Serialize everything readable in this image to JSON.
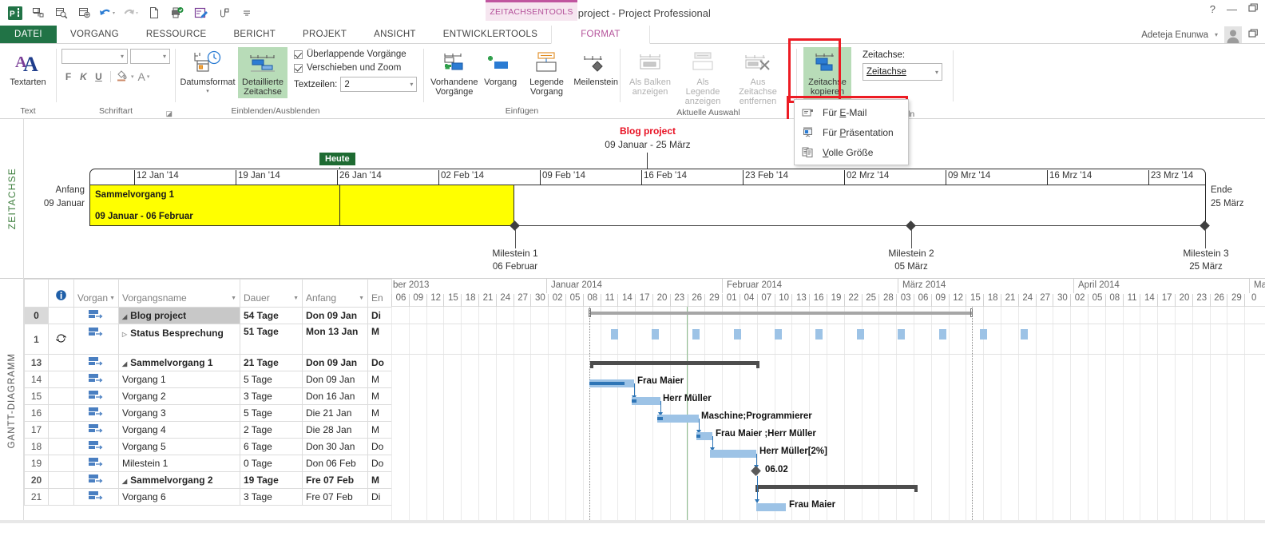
{
  "titlebar": {
    "document_title": "Blog project - Project Professional",
    "contextual_tab_group": "ZEITACHSENTOOLS",
    "quick_access": [
      "project-logo",
      "save-icon",
      "undo-icon",
      "redo-icon",
      "new-icon",
      "print-icon",
      "edit-icon",
      "link-icon",
      "customize-icon"
    ],
    "help": "?",
    "minimize": "—",
    "restore": "❐"
  },
  "tabs": [
    {
      "label": "DATEI",
      "state": "file"
    },
    {
      "label": "VORGANG",
      "state": "normal"
    },
    {
      "label": "RESSOURCE",
      "state": "normal"
    },
    {
      "label": "BERICHT",
      "state": "normal"
    },
    {
      "label": "PROJEKT",
      "state": "normal"
    },
    {
      "label": "ANSICHT",
      "state": "normal"
    },
    {
      "label": "ENTWICKLERTOOLS",
      "state": "normal"
    },
    {
      "label": "FORMAT",
      "state": "active"
    }
  ],
  "account": {
    "name": "Adeteja Enunwa",
    "caret": "▾"
  },
  "ribbon": {
    "groups": [
      {
        "name": "Text",
        "label": "Text",
        "buttons": [
          {
            "label": "Textarten",
            "icon": "text-styles-icon",
            "enabled": true
          }
        ]
      },
      {
        "name": "Schriftart",
        "label": "Schriftart",
        "font_name": "",
        "font_size": "",
        "font_buttons": [
          "F",
          "K",
          "U"
        ],
        "fill_icon": "fill-color-icon",
        "font_color_icon": "font-color-icon"
      },
      {
        "name": "Einblenden/Ausblenden",
        "label": "Einblenden/Ausblenden",
        "buttons": [
          {
            "label": "Datumsformat",
            "icon": "date-format-icon",
            "enabled": true,
            "has_caret": true
          },
          {
            "label": "Detaillierte Zeitachse",
            "icon": "detailed-timeline-icon",
            "enabled": true,
            "selected": true
          }
        ],
        "checkboxes": [
          {
            "label": "Überlappende Vorgänge",
            "checked": true
          },
          {
            "label": "Verschieben und Zoom",
            "checked": true
          }
        ],
        "textlines": {
          "label": "Textzeilen:",
          "value": "2"
        }
      },
      {
        "name": "Einfügen",
        "label": "Einfügen",
        "buttons": [
          {
            "label": "Vorhandene Vorgänge",
            "icon": "existing-tasks-icon",
            "enabled": true
          },
          {
            "label": "Vorgang",
            "icon": "task-icon",
            "enabled": true
          },
          {
            "label": "Legende Vorgang",
            "icon": "callout-task-icon",
            "enabled": true
          },
          {
            "label": "Meilenstein",
            "icon": "milestone-icon",
            "enabled": true
          }
        ]
      },
      {
        "name": "Aktuelle Auswahl",
        "label": "Aktuelle Auswahl",
        "buttons": [
          {
            "label": "Als Balken anzeigen",
            "icon": "display-as-bar-icon",
            "enabled": false
          },
          {
            "label": "Als Legende anzeigen",
            "icon": "display-as-callout-icon",
            "enabled": false
          },
          {
            "label": "Aus Zeitachse entfernen",
            "icon": "remove-from-timeline-icon",
            "enabled": false
          }
        ]
      },
      {
        "name": "Zeitachse",
        "label_partial": "seln",
        "copy_button": {
          "label_line1": "Zeitachse",
          "label_line2": "kopieren",
          "icon": "copy-timeline-icon",
          "caret": "▾",
          "selected": true
        },
        "timeline_select": {
          "label": "Zeitachse:",
          "value": "Zeitachse",
          "caret": "▾"
        }
      }
    ],
    "dropdown_menu": {
      "open": true,
      "items": [
        {
          "label": "Für E-Mail",
          "accel": "E",
          "icon": "email-icon"
        },
        {
          "label": "Für Präsentation",
          "accel": "P",
          "icon": "presentation-icon"
        },
        {
          "label": "Volle Größe",
          "accel": "V",
          "icon": "full-size-icon"
        }
      ]
    },
    "highlight_color": "#ed1c24"
  },
  "timeline": {
    "pane_label": "ZEITACHSE",
    "project_title": "Blog project",
    "project_dates": "09 Januar - 25 März",
    "today_label": "Heute",
    "start_label": "Anfang",
    "start_date": "09 Januar",
    "end_label": "Ende",
    "end_date": "25 März",
    "ticks": [
      "12 Jan '14",
      "19 Jan '14",
      "26 Jan '14",
      "02 Feb '14",
      "09 Feb '14",
      "16 Feb '14",
      "23 Feb '14",
      "02 Mrz '14",
      "09 Mrz '14",
      "16 Mrz '14",
      "23 Mrz '14"
    ],
    "bar": {
      "name": "Sammelvorgang 1",
      "dates": "09 Januar - 06 Februar",
      "color": "#ffff00"
    },
    "milestones": [
      {
        "label": "Milestein 1",
        "date": "06 Februar"
      },
      {
        "label": "Milestein 2",
        "date": "05 März"
      },
      {
        "label": "Milestein 3",
        "date": "25 März"
      }
    ]
  },
  "gantt": {
    "pane_label": "GANTT-DIAGRAMM",
    "columns": [
      {
        "key": "id",
        "label": ""
      },
      {
        "key": "info",
        "label": "ⓘ"
      },
      {
        "key": "mode",
        "label": "Vorgan"
      },
      {
        "key": "name",
        "label": "Vorgangsname"
      },
      {
        "key": "dauer",
        "label": "Dauer"
      },
      {
        "key": "anfang",
        "label": "Anfang"
      },
      {
        "key": "ende",
        "label": "En"
      }
    ],
    "rows": [
      {
        "id": "0",
        "name": "Blog project",
        "dauer": "54 Tage",
        "anfang": "Don 09 Jan",
        "ende": "Di",
        "indent": 0,
        "summary": true,
        "bold": true,
        "selected": true,
        "expander": "expanded"
      },
      {
        "id": "1",
        "name": "Status Besprechung",
        "dauer": "51 Tage",
        "anfang": "Mon 13 Jan",
        "ende": "M",
        "indent": 1,
        "summary": true,
        "bold": true,
        "selected": false,
        "expander": "collapsed",
        "info_icon": "recurring-icon"
      },
      {
        "id": "13",
        "name": "Sammelvorgang 1",
        "dauer": "21 Tage",
        "anfang": "Don 09 Jan",
        "ende": "Do",
        "indent": 1,
        "summary": true,
        "bold": true,
        "selected": false,
        "expander": "expanded"
      },
      {
        "id": "14",
        "name": "Vorgang 1",
        "dauer": "5 Tage",
        "anfang": "Don 09 Jan",
        "ende": "M",
        "indent": 2,
        "summary": false,
        "bold": false,
        "selected": false,
        "expander": "none"
      },
      {
        "id": "15",
        "name": "Vorgang 2",
        "dauer": "3 Tage",
        "anfang": "Don 16 Jan",
        "ende": "M",
        "indent": 2,
        "summary": false,
        "bold": false,
        "selected": false,
        "expander": "none"
      },
      {
        "id": "16",
        "name": "Vorgang 3",
        "dauer": "5 Tage",
        "anfang": "Die 21 Jan",
        "ende": "M",
        "indent": 2,
        "summary": false,
        "bold": false,
        "selected": false,
        "expander": "none"
      },
      {
        "id": "17",
        "name": "Vorgang 4",
        "dauer": "2 Tage",
        "anfang": "Die 28 Jan",
        "ende": "M",
        "indent": 2,
        "summary": false,
        "bold": false,
        "selected": false,
        "expander": "none"
      },
      {
        "id": "18",
        "name": "Vorgang 5",
        "dauer": "6 Tage",
        "anfang": "Don 30 Jan",
        "ende": "Do",
        "indent": 2,
        "summary": false,
        "bold": false,
        "selected": false,
        "expander": "none"
      },
      {
        "id": "19",
        "name": "Milestein 1",
        "dauer": "0 Tage",
        "anfang": "Don 06 Feb",
        "ende": "Do",
        "indent": 2,
        "summary": false,
        "bold": false,
        "selected": false,
        "expander": "none"
      },
      {
        "id": "20",
        "name": "Sammelvorgang 2",
        "dauer": "19 Tage",
        "anfang": "Fre 07 Feb",
        "ende": "M",
        "indent": 1,
        "summary": true,
        "bold": true,
        "selected": false,
        "expander": "expanded"
      },
      {
        "id": "21",
        "name": "Vorgang 6",
        "dauer": "3 Tage",
        "anfang": "Fre 07 Feb",
        "ende": "Di",
        "indent": 2,
        "summary": false,
        "bold": false,
        "selected": false,
        "expander": "none"
      }
    ],
    "timescale": {
      "months": [
        "ber 2013",
        "Januar 2014",
        "Februar 2014",
        "März 2014",
        "April 2014",
        "Ma"
      ],
      "days": [
        "06",
        "09",
        "12",
        "15",
        "18",
        "21",
        "24",
        "27",
        "30",
        "02",
        "05",
        "08",
        "11",
        "14",
        "17",
        "20",
        "23",
        "26",
        "29",
        "01",
        "04",
        "07",
        "10",
        "13",
        "16",
        "19",
        "22",
        "25",
        "28",
        "03",
        "06",
        "09",
        "12",
        "15",
        "18",
        "21",
        "24",
        "27",
        "30",
        "02",
        "05",
        "08",
        "11",
        "14",
        "17",
        "20",
        "23",
        "26",
        "29",
        "0"
      ]
    },
    "bar_labels": [
      "Frau Maier",
      "Herr Müller",
      "Maschine;Programmierer",
      "Frau Maier ;Herr Müller",
      "Herr Müller[2%]",
      "06.02",
      "Frau Maier"
    ]
  }
}
